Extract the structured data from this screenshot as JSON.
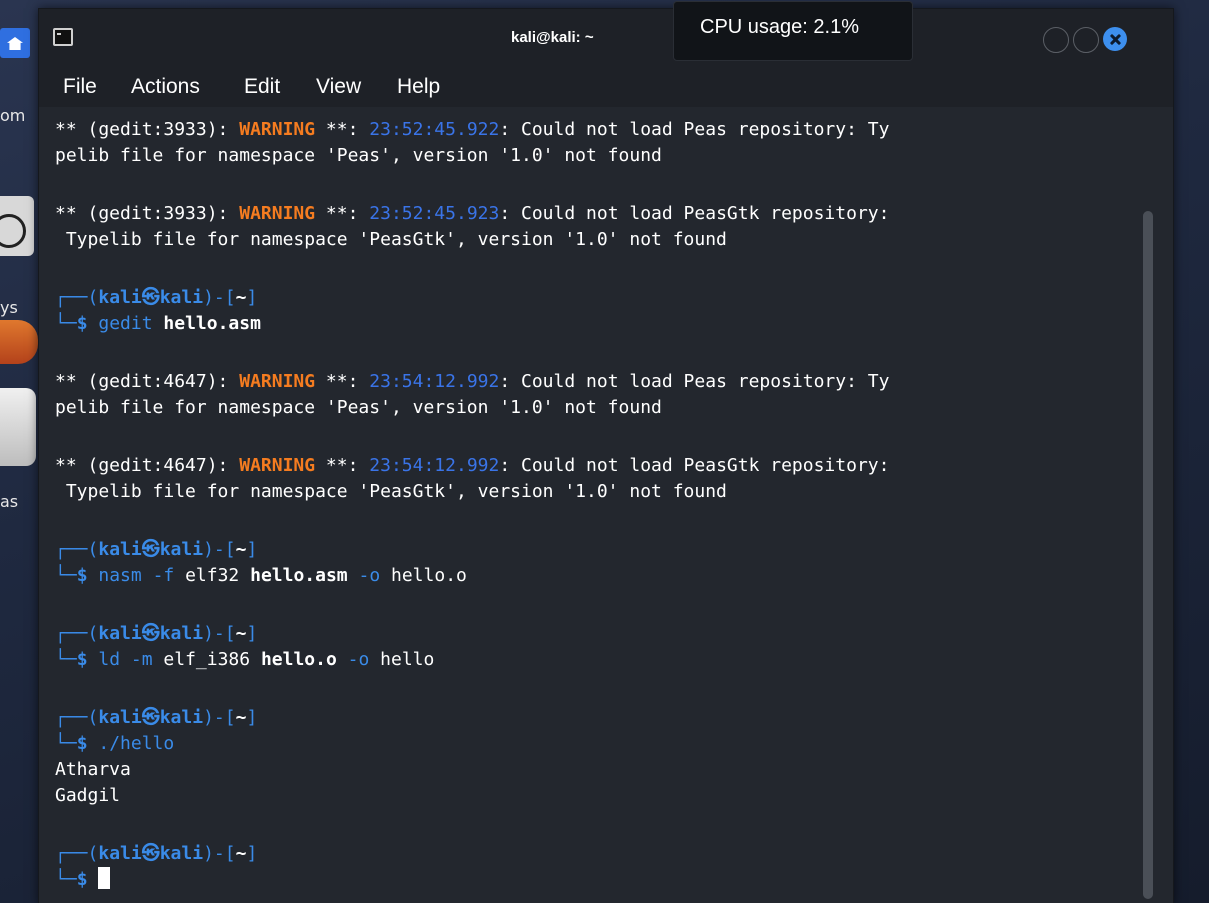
{
  "desktop": {
    "labels": [
      "om",
      "ys",
      "as"
    ]
  },
  "window": {
    "title": "kali@kali: ~",
    "cpu_usage": "CPU usage: 2.1%"
  },
  "menu": [
    "File",
    "Actions",
    "Edit",
    "View",
    "Help"
  ],
  "terminal": {
    "warn_prefix_1": "** (gedit:3933): ",
    "warn_prefix_2": "** (gedit:4647): ",
    "warning_word": "WARNING",
    "warn_sep": " **: ",
    "timestamps": [
      "23:52:45.922",
      "23:52:45.923",
      "23:54:12.992",
      "23:54:12.992"
    ],
    "msg_peas_1": ": Could not load Peas repository: Ty",
    "msg_peas_2": "pelib file for namespace 'Peas', version '1.0' not found",
    "msg_peasgtk_1": ": Could not load PeasGtk repository:",
    "msg_peasgtk_2": " Typelib file for namespace 'PeasGtk', version '1.0' not found",
    "prompt_open": "┌──(",
    "prompt_user": "kali",
    "prompt_at": "㉿",
    "prompt_host": "kali",
    "prompt_close": ")-[",
    "prompt_dir": "~",
    "prompt_end": "]",
    "prompt_dollar_prefix": "└─",
    "prompt_dollar": "$",
    "cmd1_name": " gedit ",
    "cmd1_arg": "hello.asm",
    "cmd2_name": " nasm ",
    "cmd2_opt1": "-f",
    "cmd2_mid": " elf32 ",
    "cmd2_arg": "hello.asm",
    "cmd2_opt2": " -o",
    "cmd2_out": " hello.o",
    "cmd3_name": " ld ",
    "cmd3_opt1": "-m",
    "cmd3_mid": " elf_i386 ",
    "cmd3_arg": "hello.o",
    "cmd3_opt2": " -o",
    "cmd3_out": " hello",
    "cmd4": " ./hello",
    "output": [
      "Atharva",
      "Gadgil"
    ]
  }
}
